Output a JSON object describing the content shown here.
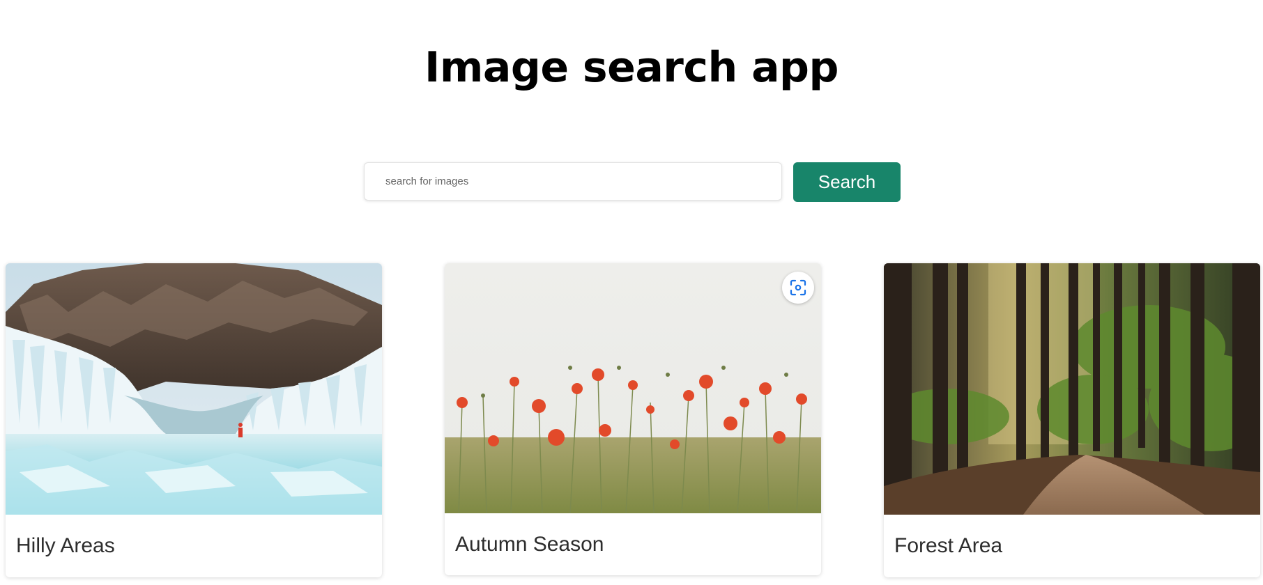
{
  "header": {
    "title": "Image search app"
  },
  "search": {
    "placeholder": "search for images",
    "value": "",
    "button_label": "Search"
  },
  "results": [
    {
      "caption": "Hilly Areas",
      "image": "icy-cliff-photo"
    },
    {
      "caption": "Autumn Season",
      "image": "poppy-field-photo"
    },
    {
      "caption": "Forest Area",
      "image": "forest-path-photo"
    }
  ],
  "colors": {
    "accent": "#18856a",
    "title": "#000000",
    "caption": "#2d2d2d",
    "lens_icon": "#1a73e8"
  },
  "icons": {
    "lens": "visual-search-icon"
  }
}
